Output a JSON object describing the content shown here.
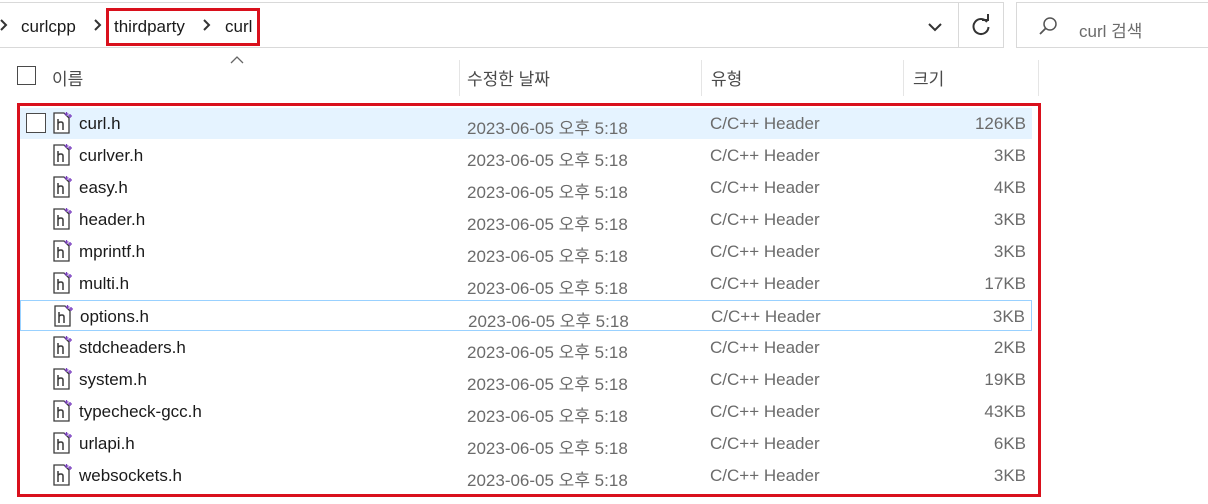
{
  "breadcrumb": {
    "items": [
      {
        "label": "curlcpp"
      },
      {
        "label": "thirdparty"
      },
      {
        "label": "curl"
      }
    ]
  },
  "search": {
    "placeholder": "curl 검색"
  },
  "columns": {
    "name": "이름",
    "date": "수정한 날짜",
    "type": "유형",
    "size": "크기"
  },
  "files": [
    {
      "name": "curl.h",
      "date": "2023-06-05 오후 5:18",
      "type": "C/C++ Header",
      "size": "126KB"
    },
    {
      "name": "curlver.h",
      "date": "2023-06-05 오후 5:18",
      "type": "C/C++ Header",
      "size": "3KB"
    },
    {
      "name": "easy.h",
      "date": "2023-06-05 오후 5:18",
      "type": "C/C++ Header",
      "size": "4KB"
    },
    {
      "name": "header.h",
      "date": "2023-06-05 오후 5:18",
      "type": "C/C++ Header",
      "size": "3KB"
    },
    {
      "name": "mprintf.h",
      "date": "2023-06-05 오후 5:18",
      "type": "C/C++ Header",
      "size": "3KB"
    },
    {
      "name": "multi.h",
      "date": "2023-06-05 오후 5:18",
      "type": "C/C++ Header",
      "size": "17KB"
    },
    {
      "name": "options.h",
      "date": "2023-06-05 오후 5:18",
      "type": "C/C++ Header",
      "size": "3KB"
    },
    {
      "name": "stdcheaders.h",
      "date": "2023-06-05 오후 5:18",
      "type": "C/C++ Header",
      "size": "2KB"
    },
    {
      "name": "system.h",
      "date": "2023-06-05 오후 5:18",
      "type": "C/C++ Header",
      "size": "19KB"
    },
    {
      "name": "typecheck-gcc.h",
      "date": "2023-06-05 오후 5:18",
      "type": "C/C++ Header",
      "size": "43KB"
    },
    {
      "name": "urlapi.h",
      "date": "2023-06-05 오후 5:18",
      "type": "C/C++ Header",
      "size": "6KB"
    },
    {
      "name": "websockets.h",
      "date": "2023-06-05 오후 5:18",
      "type": "C/C++ Header",
      "size": "3KB"
    }
  ],
  "icons": {
    "breadcrumb_separator": "chevron-right-icon",
    "history": "chevron-down-icon",
    "refresh": "refresh-icon",
    "search": "search-icon",
    "file": "header-file-icon",
    "sort": "sort-ascending-icon"
  },
  "colors": {
    "highlight": "#d9101c",
    "selection": "#e5f3ff",
    "focus_border": "#99d1ff",
    "file_icon_accent": "#7a3fbf"
  }
}
